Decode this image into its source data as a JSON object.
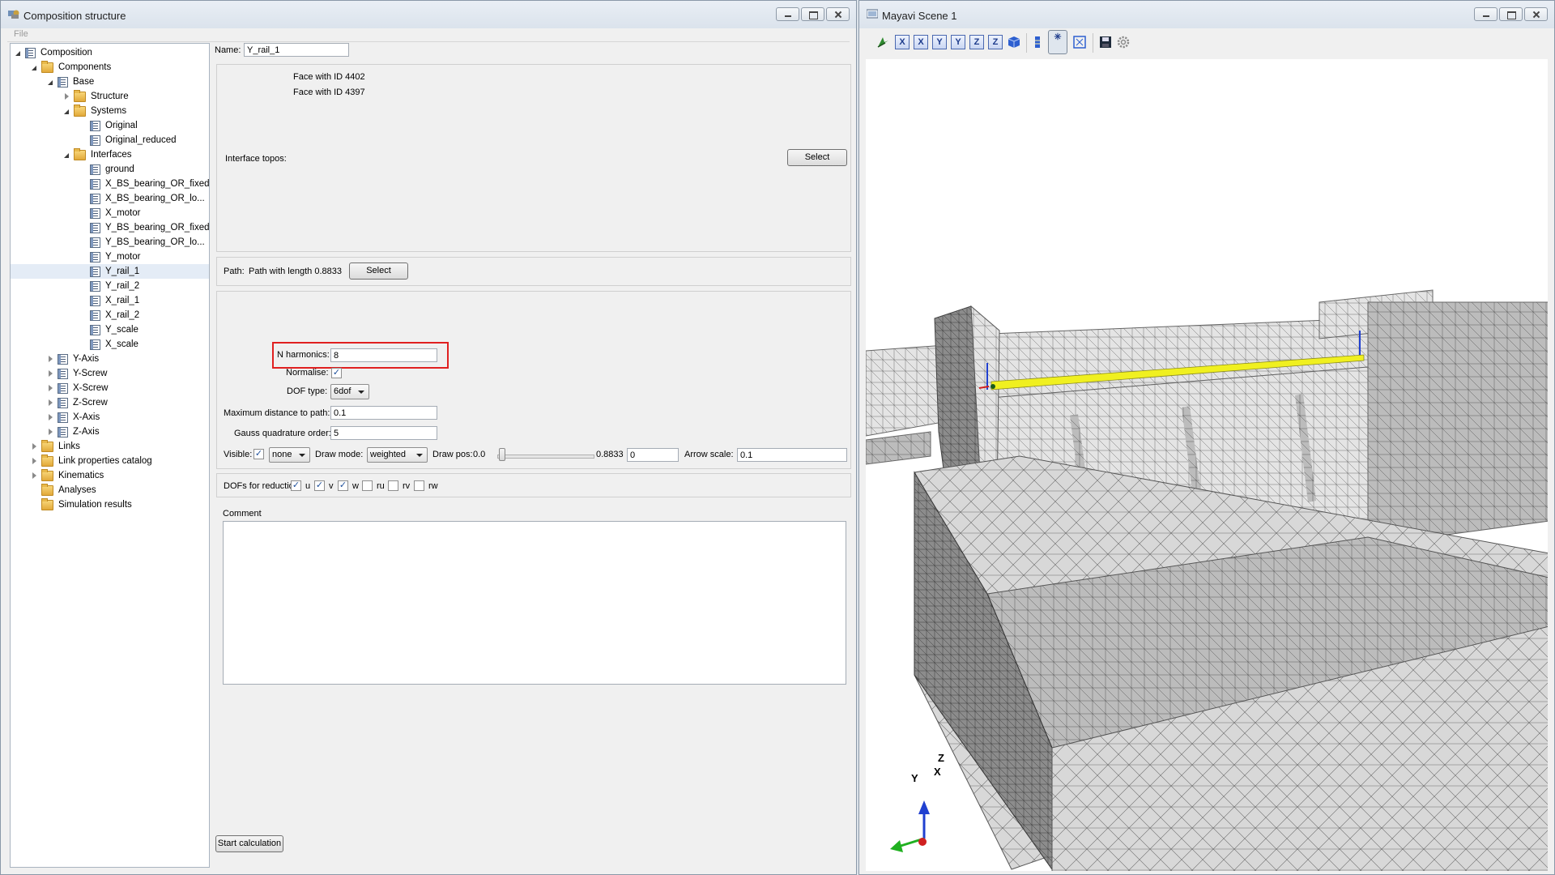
{
  "left_window": {
    "title": "Composition structure",
    "menu": {
      "file": "File"
    },
    "tree": [
      {
        "label": "Composition",
        "icon": "doc",
        "expander": "open",
        "level": 0
      },
      {
        "label": "Components",
        "icon": "folder",
        "expander": "open",
        "level": 1
      },
      {
        "label": "Base",
        "icon": "doc",
        "expander": "open",
        "level": 2
      },
      {
        "label": "Structure",
        "icon": "folder",
        "expander": "closed",
        "level": 3
      },
      {
        "label": "Systems",
        "icon": "folder",
        "expander": "open",
        "level": 3
      },
      {
        "label": "Original",
        "icon": "doc",
        "expander": "none",
        "level": 4
      },
      {
        "label": "Original_reduced",
        "icon": "doc",
        "expander": "none",
        "level": 4
      },
      {
        "label": "Interfaces",
        "icon": "folder",
        "expander": "open",
        "level": 3
      },
      {
        "label": "ground",
        "icon": "doc",
        "expander": "none",
        "level": 4
      },
      {
        "label": "X_BS_bearing_OR_fixed",
        "icon": "doc",
        "expander": "none",
        "level": 4
      },
      {
        "label": "X_BS_bearing_OR_lo...",
        "icon": "doc",
        "expander": "none",
        "level": 4
      },
      {
        "label": "X_motor",
        "icon": "doc",
        "expander": "none",
        "level": 4
      },
      {
        "label": "Y_BS_bearing_OR_fixed",
        "icon": "doc",
        "expander": "none",
        "level": 4
      },
      {
        "label": "Y_BS_bearing_OR_lo...",
        "icon": "doc",
        "expander": "none",
        "level": 4
      },
      {
        "label": "Y_motor",
        "icon": "doc",
        "expander": "none",
        "level": 4
      },
      {
        "label": "Y_rail_1",
        "icon": "doc",
        "expander": "none",
        "level": 4,
        "selected": true
      },
      {
        "label": "Y_rail_2",
        "icon": "doc",
        "expander": "none",
        "level": 4
      },
      {
        "label": "X_rail_1",
        "icon": "doc",
        "expander": "none",
        "level": 4
      },
      {
        "label": "X_rail_2",
        "icon": "doc",
        "expander": "none",
        "level": 4
      },
      {
        "label": "Y_scale",
        "icon": "doc",
        "expander": "none",
        "level": 4
      },
      {
        "label": "X_scale",
        "icon": "doc",
        "expander": "none",
        "level": 4
      },
      {
        "label": "Y-Axis",
        "icon": "doc",
        "expander": "closed",
        "level": 2
      },
      {
        "label": "Y-Screw",
        "icon": "doc",
        "expander": "closed",
        "level": 2
      },
      {
        "label": "X-Screw",
        "icon": "doc",
        "expander": "closed",
        "level": 2
      },
      {
        "label": "Z-Screw",
        "icon": "doc",
        "expander": "closed",
        "level": 2
      },
      {
        "label": "X-Axis",
        "icon": "doc",
        "expander": "closed",
        "level": 2
      },
      {
        "label": "Z-Axis",
        "icon": "doc",
        "expander": "closed",
        "level": 2
      },
      {
        "label": "Links",
        "icon": "folder",
        "expander": "closed",
        "level": 1
      },
      {
        "label": "Link properties catalog",
        "icon": "folder",
        "expander": "closed",
        "level": 1
      },
      {
        "label": "Kinematics",
        "icon": "folder",
        "expander": "closed",
        "level": 1
      },
      {
        "label": "Analyses",
        "icon": "folder",
        "expander": "none",
        "level": 1
      },
      {
        "label": "Simulation results",
        "icon": "folder",
        "expander": "none",
        "level": 1
      }
    ],
    "form": {
      "name_label": "Name:",
      "name_value": "Y_rail_1",
      "faces": [
        "Face with ID 4402",
        "Face with ID 4397"
      ],
      "interface_topos_label": "Interface topos:",
      "select_label": "Select",
      "path_label": "Path:",
      "path_value": "Path with length 0.8833",
      "path_select_label": "Select",
      "n_harmonics_label": "N harmonics:",
      "n_harmonics_value": "8",
      "normalise_label": "Normalise:",
      "normalise_checked": true,
      "dof_type_label": "DOF type:",
      "dof_type_value": "6dof",
      "max_dist_label": "Maximum distance to path:",
      "max_dist_value": "0.1",
      "gauss_label": "Gauss quadrature order:",
      "gauss_value": "5",
      "visible_label": "Visible:",
      "visible_checked": true,
      "visible_mode": "none",
      "draw_mode_label": "Draw mode:",
      "draw_mode_value": "weighted",
      "draw_pos_label": "Draw pos:",
      "draw_pos_min": "0.0",
      "draw_pos_max": "0.8833",
      "draw_pos_value": "0",
      "draw_pos_fraction": 0.0,
      "arrow_scale_label": "Arrow scale:",
      "arrow_scale_value": "0.1",
      "dofs_label": "DOFs for reduction:",
      "dofs": [
        {
          "label": "u",
          "checked": true
        },
        {
          "label": "v",
          "checked": true
        },
        {
          "label": "w",
          "checked": true
        },
        {
          "label": "ru",
          "checked": false
        },
        {
          "label": "rv",
          "checked": false
        },
        {
          "label": "rw",
          "checked": false
        }
      ],
      "comment_label": "Comment",
      "start_label": "Start calculation"
    }
  },
  "right_window": {
    "title": "Mayavi Scene 1",
    "toolbar": [
      "arrow-icon",
      "view-x-plus",
      "view-x-minus",
      "view-y-plus",
      "view-y-minus",
      "view-z-plus",
      "view-z-minus",
      "view-iso",
      "toggle-bar",
      "parallel-projection",
      "fit-view",
      "save-icon",
      "settings-icon"
    ],
    "toolbar_letters": [
      "X",
      "X",
      "Y",
      "Y",
      "Z",
      "Z"
    ],
    "axes": {
      "z": "Z",
      "y": "Y",
      "x": "X"
    }
  },
  "colors": {
    "highlight": "#e02020",
    "rail": "#f0f020",
    "mesh_light": "#d9d9d9",
    "mesh_dark": "#8f8f8f"
  }
}
